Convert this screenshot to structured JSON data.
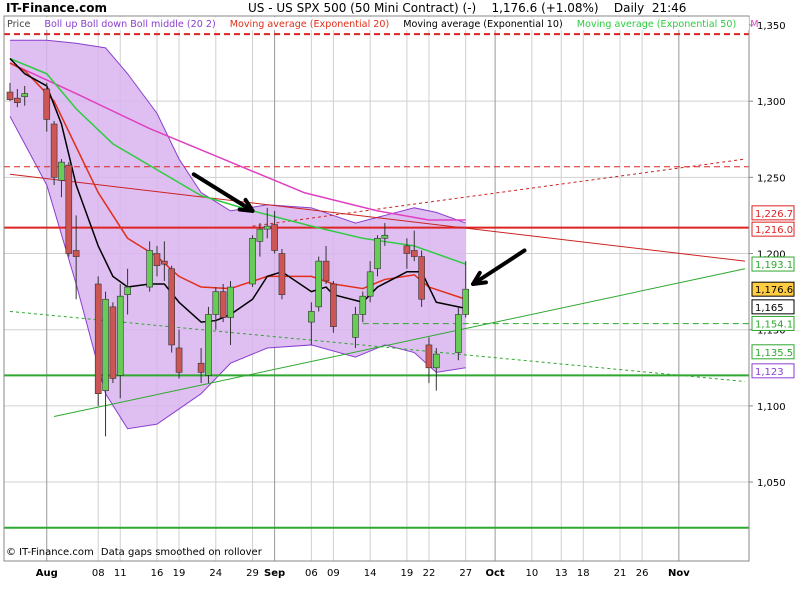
{
  "header": {
    "brand": "IT-Finance.com",
    "title": "US - US SPX 500 (50 Mini Contract) (-)    1,176.6 (+1.08%)    Daily  21:46"
  },
  "legend": [
    {
      "label": "Price",
      "color": "#444444"
    },
    {
      "label": "Boll up Boll down Boll middle (20 2)",
      "color": "#8a3fcf"
    },
    {
      "label": "Moving average (Exponential 20)",
      "color": "#e0301a"
    },
    {
      "label": "Moving average (Exponential 10)",
      "color": "#000000"
    },
    {
      "label": "Moving average (Exponential 50)",
      "color": "#2ecc40"
    },
    {
      "label": "M",
      "color": "#e040c0"
    }
  ],
  "footer": {
    "copyright": "© IT-Finance.com",
    "note": "Data gaps smoothed on rollover"
  },
  "chart_data": {
    "type": "candlestick",
    "ylim": [
      1010,
      1350
    ],
    "yticks": [
      {
        "value": 1350,
        "label": "1,350"
      },
      {
        "value": 1300,
        "label": "1,300"
      },
      {
        "value": 1250,
        "label": "1,250"
      },
      {
        "value": 1200,
        "label": "1,200"
      },
      {
        "value": 1150,
        "label": "1,150"
      },
      {
        "value": 1100,
        "label": "1,100"
      },
      {
        "value": 1050,
        "label": "1,050"
      }
    ],
    "x_start_date": "2011-07-27",
    "x_end_date": "2011-11-04",
    "xticks": [
      {
        "date": "2011-08-01",
        "label": "Aug",
        "major": true
      },
      {
        "date": "2011-08-08",
        "label": "08"
      },
      {
        "date": "2011-08-11",
        "label": "11"
      },
      {
        "date": "2011-08-16",
        "label": "16"
      },
      {
        "date": "2011-08-19",
        "label": "19"
      },
      {
        "date": "2011-08-24",
        "label": "24"
      },
      {
        "date": "2011-08-29",
        "label": "29"
      },
      {
        "date": "2011-09-01",
        "label": "Sep",
        "major": true
      },
      {
        "date": "2011-09-06",
        "label": "06"
      },
      {
        "date": "2011-09-09",
        "label": "09"
      },
      {
        "date": "2011-09-14",
        "label": "14"
      },
      {
        "date": "2011-09-19",
        "label": "19"
      },
      {
        "date": "2011-09-22",
        "label": "22"
      },
      {
        "date": "2011-09-27",
        "label": "27"
      },
      {
        "date": "2011-10-01",
        "label": "Oct",
        "major": true
      },
      {
        "date": "2011-10-06",
        "label": "10"
      },
      {
        "date": "2011-10-10",
        "label": "13"
      },
      {
        "date": "2011-10-13",
        "label": "18"
      },
      {
        "date": "2011-10-18",
        "label": "21"
      },
      {
        "date": "2011-10-21",
        "label": "26"
      },
      {
        "date": "2011-10-26",
        "label": "Nov",
        "major": true
      }
    ],
    "candles": [
      {
        "date": "2011-07-27",
        "o": 1306,
        "h": 1312,
        "l": 1300,
        "c": 1301
      },
      {
        "date": "2011-07-28",
        "o": 1302,
        "h": 1308,
        "l": 1296,
        "c": 1299
      },
      {
        "date": "2011-07-29",
        "o": 1303,
        "h": 1310,
        "l": 1297,
        "c": 1305
      },
      {
        "date": "2011-08-01",
        "o": 1308,
        "h": 1312,
        "l": 1280,
        "c": 1288
      },
      {
        "date": "2011-08-02",
        "o": 1285,
        "h": 1287,
        "l": 1245,
        "c": 1250
      },
      {
        "date": "2011-08-03",
        "o": 1248,
        "h": 1262,
        "l": 1237,
        "c": 1260
      },
      {
        "date": "2011-08-04",
        "o": 1258,
        "h": 1260,
        "l": 1198,
        "c": 1200
      },
      {
        "date": "2011-08-05",
        "o": 1202,
        "h": 1225,
        "l": 1170,
        "c": 1198
      },
      {
        "date": "2011-08-08",
        "o": 1180,
        "h": 1185,
        "l": 1100,
        "c": 1108
      },
      {
        "date": "2011-08-09",
        "o": 1110,
        "h": 1175,
        "l": 1080,
        "c": 1170
      },
      {
        "date": "2011-08-10",
        "o": 1165,
        "h": 1168,
        "l": 1115,
        "c": 1118
      },
      {
        "date": "2011-08-11",
        "o": 1120,
        "h": 1180,
        "l": 1105,
        "c": 1172
      },
      {
        "date": "2011-08-12",
        "o": 1173,
        "h": 1190,
        "l": 1160,
        "c": 1178
      },
      {
        "date": "2011-08-15",
        "o": 1178,
        "h": 1208,
        "l": 1175,
        "c": 1202
      },
      {
        "date": "2011-08-16",
        "o": 1200,
        "h": 1205,
        "l": 1185,
        "c": 1192
      },
      {
        "date": "2011-08-17",
        "o": 1195,
        "h": 1208,
        "l": 1182,
        "c": 1193
      },
      {
        "date": "2011-08-18",
        "o": 1190,
        "h": 1192,
        "l": 1135,
        "c": 1140
      },
      {
        "date": "2011-08-19",
        "o": 1138,
        "h": 1150,
        "l": 1118,
        "c": 1122
      },
      {
        "date": "2011-08-22",
        "o": 1128,
        "h": 1138,
        "l": 1115,
        "c": 1122
      },
      {
        "date": "2011-08-23",
        "o": 1120,
        "h": 1165,
        "l": 1115,
        "c": 1160
      },
      {
        "date": "2011-08-24",
        "o": 1160,
        "h": 1178,
        "l": 1150,
        "c": 1175
      },
      {
        "date": "2011-08-25",
        "o": 1175,
        "h": 1180,
        "l": 1155,
        "c": 1158
      },
      {
        "date": "2011-08-26",
        "o": 1158,
        "h": 1182,
        "l": 1140,
        "c": 1178
      },
      {
        "date": "2011-08-29",
        "o": 1180,
        "h": 1212,
        "l": 1178,
        "c": 1210
      },
      {
        "date": "2011-08-30",
        "o": 1208,
        "h": 1220,
        "l": 1198,
        "c": 1216
      },
      {
        "date": "2011-08-31",
        "o": 1216,
        "h": 1230,
        "l": 1210,
        "c": 1218
      },
      {
        "date": "2011-09-01",
        "o": 1219,
        "h": 1228,
        "l": 1200,
        "c": 1202
      },
      {
        "date": "2011-09-02",
        "o": 1200,
        "h": 1203,
        "l": 1170,
        "c": 1173
      },
      {
        "date": "2011-09-06",
        "o": 1155,
        "h": 1168,
        "l": 1140,
        "c": 1162
      },
      {
        "date": "2011-09-07",
        "o": 1165,
        "h": 1198,
        "l": 1162,
        "c": 1195
      },
      {
        "date": "2011-09-08",
        "o": 1195,
        "h": 1205,
        "l": 1180,
        "c": 1182
      },
      {
        "date": "2011-09-09",
        "o": 1180,
        "h": 1182,
        "l": 1148,
        "c": 1152
      },
      {
        "date": "2011-09-12",
        "o": 1145,
        "h": 1165,
        "l": 1138,
        "c": 1160
      },
      {
        "date": "2011-09-13",
        "o": 1160,
        "h": 1175,
        "l": 1155,
        "c": 1172
      },
      {
        "date": "2011-09-14",
        "o": 1172,
        "h": 1195,
        "l": 1168,
        "c": 1188
      },
      {
        "date": "2011-09-15",
        "o": 1190,
        "h": 1212,
        "l": 1185,
        "c": 1210
      },
      {
        "date": "2011-09-16",
        "o": 1210,
        "h": 1220,
        "l": 1205,
        "c": 1212
      },
      {
        "date": "2011-09-19",
        "o": 1205,
        "h": 1210,
        "l": 1190,
        "c": 1200
      },
      {
        "date": "2011-09-20",
        "o": 1202,
        "h": 1215,
        "l": 1195,
        "c": 1198
      },
      {
        "date": "2011-09-21",
        "o": 1198,
        "h": 1202,
        "l": 1165,
        "c": 1170
      },
      {
        "date": "2011-09-22",
        "o": 1140,
        "h": 1145,
        "l": 1115,
        "c": 1125
      },
      {
        "date": "2011-09-23",
        "o": 1125,
        "h": 1138,
        "l": 1110,
        "c": 1134
      },
      {
        "date": "2011-09-26",
        "o": 1135,
        "h": 1165,
        "l": 1130,
        "c": 1160
      },
      {
        "date": "2011-09-27",
        "o": 1160,
        "h": 1195,
        "l": 1158,
        "c": 1176.6
      }
    ],
    "ema10": [
      [
        "2011-07-27",
        1328
      ],
      [
        "2011-07-29",
        1318
      ],
      [
        "2011-08-01",
        1310
      ],
      [
        "2011-08-03",
        1285
      ],
      [
        "2011-08-05",
        1245
      ],
      [
        "2011-08-08",
        1205
      ],
      [
        "2011-08-10",
        1185
      ],
      [
        "2011-08-12",
        1178
      ],
      [
        "2011-08-15",
        1180
      ],
      [
        "2011-08-17",
        1180
      ],
      [
        "2011-08-19",
        1168
      ],
      [
        "2011-08-22",
        1155
      ],
      [
        "2011-08-24",
        1156
      ],
      [
        "2011-08-26",
        1160
      ],
      [
        "2011-08-29",
        1170
      ],
      [
        "2011-08-31",
        1185
      ],
      [
        "2011-09-02",
        1188
      ],
      [
        "2011-09-06",
        1175
      ],
      [
        "2011-09-08",
        1178
      ],
      [
        "2011-09-09",
        1173
      ],
      [
        "2011-09-13",
        1168
      ],
      [
        "2011-09-15",
        1178
      ],
      [
        "2011-09-19",
        1188
      ],
      [
        "2011-09-21",
        1188
      ],
      [
        "2011-09-23",
        1168
      ],
      [
        "2011-09-27",
        1164
      ]
    ],
    "ema20": [
      [
        "2011-07-27",
        1325
      ],
      [
        "2011-07-29",
        1320
      ],
      [
        "2011-08-02",
        1300
      ],
      [
        "2011-08-05",
        1270
      ],
      [
        "2011-08-08",
        1240
      ],
      [
        "2011-08-12",
        1210
      ],
      [
        "2011-08-16",
        1198
      ],
      [
        "2011-08-19",
        1185
      ],
      [
        "2011-08-22",
        1178
      ],
      [
        "2011-08-26",
        1177
      ],
      [
        "2011-08-31",
        1185
      ],
      [
        "2011-09-06",
        1185
      ],
      [
        "2011-09-09",
        1180
      ],
      [
        "2011-09-13",
        1177
      ],
      [
        "2011-09-16",
        1183
      ],
      [
        "2011-09-20",
        1186
      ],
      [
        "2011-09-22",
        1178
      ],
      [
        "2011-09-27",
        1170
      ]
    ],
    "ema50": [
      [
        "2011-07-27",
        1328
      ],
      [
        "2011-08-01",
        1318
      ],
      [
        "2011-08-05",
        1295
      ],
      [
        "2011-08-10",
        1272
      ],
      [
        "2011-08-16",
        1255
      ],
      [
        "2011-08-22",
        1238
      ],
      [
        "2011-08-29",
        1228
      ],
      [
        "2011-09-06",
        1218
      ],
      [
        "2011-09-13",
        1210
      ],
      [
        "2011-09-20",
        1205
      ],
      [
        "2011-09-27",
        1193
      ]
    ],
    "ma_magenta": [
      [
        "2011-07-27",
        1325
      ],
      [
        "2011-08-05",
        1305
      ],
      [
        "2011-08-15",
        1282
      ],
      [
        "2011-08-25",
        1262
      ],
      [
        "2011-09-05",
        1240
      ],
      [
        "2011-09-15",
        1228
      ],
      [
        "2011-09-22",
        1222
      ],
      [
        "2011-09-27",
        1222
      ]
    ],
    "boll_upper": [
      [
        "2011-07-27",
        1340
      ],
      [
        "2011-08-01",
        1340
      ],
      [
        "2011-08-05",
        1338
      ],
      [
        "2011-08-09",
        1335
      ],
      [
        "2011-08-12",
        1318
      ],
      [
        "2011-08-16",
        1292
      ],
      [
        "2011-08-19",
        1262
      ],
      [
        "2011-08-22",
        1240
      ],
      [
        "2011-08-26",
        1228
      ],
      [
        "2011-08-31",
        1232
      ],
      [
        "2011-09-06",
        1230
      ],
      [
        "2011-09-12",
        1220
      ],
      [
        "2011-09-16",
        1225
      ],
      [
        "2011-09-20",
        1230
      ],
      [
        "2011-09-23",
        1227
      ],
      [
        "2011-09-27",
        1220
      ]
    ],
    "boll_lower": [
      [
        "2011-07-27",
        1290
      ],
      [
        "2011-08-01",
        1245
      ],
      [
        "2011-08-05",
        1180
      ],
      [
        "2011-08-09",
        1108
      ],
      [
        "2011-08-12",
        1085
      ],
      [
        "2011-08-16",
        1088
      ],
      [
        "2011-08-19",
        1098
      ],
      [
        "2011-08-22",
        1108
      ],
      [
        "2011-08-26",
        1128
      ],
      [
        "2011-08-31",
        1138
      ],
      [
        "2011-09-06",
        1140
      ],
      [
        "2011-09-12",
        1132
      ],
      [
        "2011-09-16",
        1140
      ],
      [
        "2011-09-20",
        1135
      ],
      [
        "2011-09-23",
        1122
      ],
      [
        "2011-09-27",
        1125
      ]
    ],
    "trendlines": [
      {
        "from": [
          "2011-07-27",
          1252
        ],
        "to": [
          "2011-11-04",
          1195
        ],
        "color": "#cc2222",
        "dash": false
      },
      {
        "from": [
          "2011-08-29",
          1218
        ],
        "to": [
          "2011-11-04",
          1262
        ],
        "color": "#cc2222",
        "dash": true
      },
      {
        "from": [
          "2011-08-02",
          1093
        ],
        "to": [
          "2011-11-04",
          1190
        ],
        "color": "#2ea82e",
        "dash": false
      },
      {
        "from": [
          "2011-07-27",
          1162
        ],
        "to": [
          "2011-11-04",
          1116
        ],
        "color": "#2ea82e",
        "dash": true
      }
    ],
    "hlines": [
      {
        "value": 1344,
        "color": "#dd2222",
        "width": 2,
        "dash": true
      },
      {
        "value": 1257,
        "color": "#dd2222",
        "width": 1,
        "dash": true
      },
      {
        "value": 1217,
        "color": "#dd2222",
        "width": 2,
        "dash": false
      },
      {
        "value": 1154,
        "color": "#2ea82e",
        "width": 1,
        "dash": true,
        "from_date": "2011-09-13"
      },
      {
        "value": 1120,
        "color": "#2ea82e",
        "width": 2,
        "dash": false
      },
      {
        "value": 1020,
        "color": "#2ea82e",
        "width": 2,
        "dash": false
      }
    ],
    "price_labels": [
      {
        "value": 1226.7,
        "label": "1,226.7",
        "color": "#dd2222",
        "bg": "#ffffff"
      },
      {
        "value": 1216.0,
        "label": "1,216.0",
        "color": "#dd2222",
        "bg": "#ffffff"
      },
      {
        "value": 1193.1,
        "label": "1,193.1",
        "color": "#2ea82e",
        "bg": "#ffffff"
      },
      {
        "value": 1176.6,
        "label": "1,176.6",
        "color": "#000000",
        "bg": "#ffcc44"
      },
      {
        "value": 1165.0,
        "label": "1,165",
        "color": "#000000",
        "bg": "#ffffff"
      },
      {
        "value": 1154.1,
        "label": "1,154.1",
        "color": "#2ea82e",
        "bg": "#ffffff"
      },
      {
        "value": 1135.5,
        "label": "1,135.5",
        "color": "#2ea82e",
        "bg": "#ffffff"
      },
      {
        "value": 1123,
        "label": "1,123",
        "color": "#8a3fcf",
        "bg": "#ffffff"
      }
    ],
    "annotations": [
      {
        "type": "arrow",
        "from": [
          "2011-08-21",
          1252
        ],
        "to": [
          "2011-08-29",
          1228
        ]
      },
      {
        "type": "arrow",
        "from": [
          "2011-10-05",
          1202
        ],
        "to": [
          "2011-09-28",
          1180
        ]
      }
    ],
    "colors": {
      "up_body": "#66cc55",
      "down_body": "#cc5555",
      "boll_fill": "#d9b3ee",
      "boll_line": "#8a3fcf",
      "ema10": "#000000",
      "ema20": "#e0301a",
      "ema50": "#2ecc40",
      "ma_magenta": "#e040c0",
      "grid": "#d0d0d0"
    }
  }
}
